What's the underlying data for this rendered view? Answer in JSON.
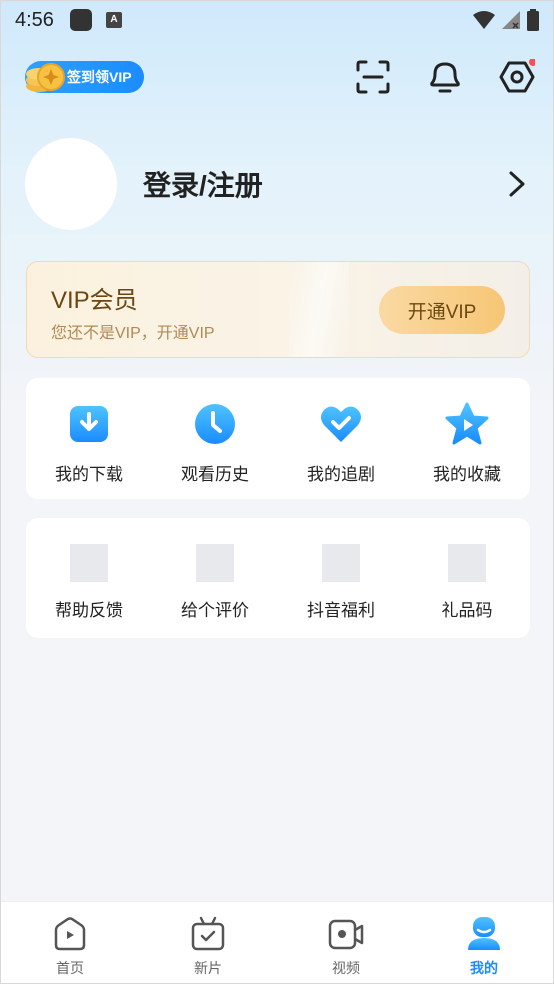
{
  "status_bar": {
    "time": "4:56",
    "a_badge": "A"
  },
  "header": {
    "checkin_label": "签到领VIP"
  },
  "profile": {
    "login_label": "登录/注册"
  },
  "vip": {
    "title": "VIP会员",
    "subtitle": "您还不是VIP，开通VIP",
    "button_label": "开通VIP"
  },
  "quick_actions": [
    {
      "label": "我的下载",
      "icon": "download-icon"
    },
    {
      "label": "观看历史",
      "icon": "clock-icon"
    },
    {
      "label": "我的追剧",
      "icon": "heart-check-icon"
    },
    {
      "label": "我的收藏",
      "icon": "star-play-icon"
    }
  ],
  "more_services": [
    {
      "label": "帮助反馈"
    },
    {
      "label": "给个评价"
    },
    {
      "label": "抖音福利"
    },
    {
      "label": "礼品码"
    }
  ],
  "tabs": [
    {
      "label": "首页",
      "icon": "home-play-icon"
    },
    {
      "label": "新片",
      "icon": "tv-check-icon"
    },
    {
      "label": "视频",
      "icon": "video-camera-icon"
    },
    {
      "label": "我的",
      "icon": "user-icon",
      "active": true
    }
  ],
  "colors": {
    "accent": "#1a8cff",
    "vip_text": "#6b4714",
    "vip_button": "#f6c675",
    "notification_dot": "#ff4d4f"
  }
}
